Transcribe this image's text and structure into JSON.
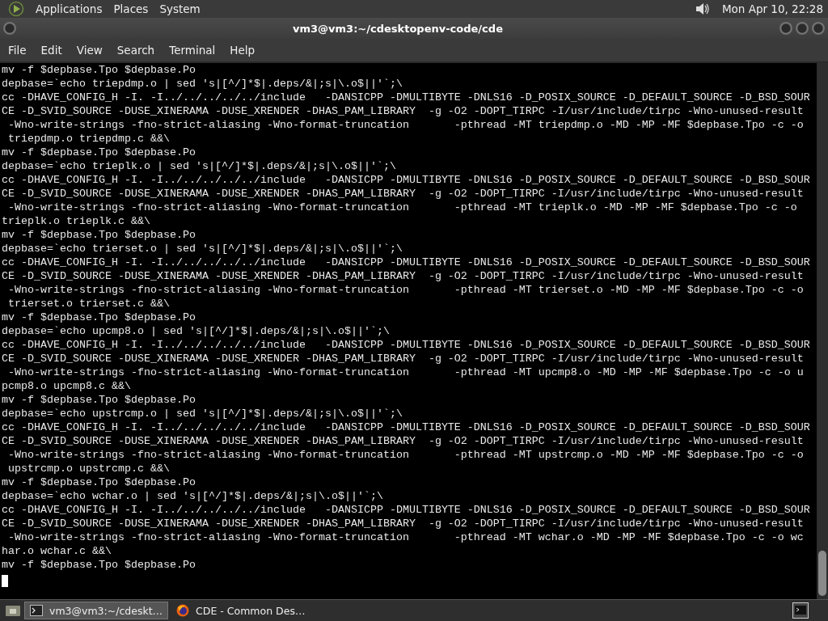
{
  "top_panel": {
    "menus": [
      "Applications",
      "Places",
      "System"
    ],
    "clock": "Mon Apr 10, 22:28"
  },
  "window": {
    "title": "vm3@vm3:~/cdesktopenv-code/cde"
  },
  "menu_bar": [
    "File",
    "Edit",
    "View",
    "Search",
    "Terminal",
    "Help"
  ],
  "terminal": {
    "lines": [
      "mv -f $depbase.Tpo $depbase.Po",
      "depbase=`echo triepdmp.o | sed 's|[^/]*$|.deps/&|;s|\\.o$||'`;\\",
      "cc -DHAVE_CONFIG_H -I. -I../../../../../include   -DANSICPP -DMULTIBYTE -DNLS16 -D_POSIX_SOURCE -D_DEFAULT_SOURCE -D_BSD_SOUR",
      "CE -D_SVID_SOURCE -DUSE_XINERAMA -DUSE_XRENDER -DHAS_PAM_LIBRARY  -g -O2 -DOPT_TIRPC -I/usr/include/tirpc -Wno-unused-result",
      " -Wno-write-strings -fno-strict-aliasing -Wno-format-truncation       -pthread -MT triepdmp.o -MD -MP -MF $depbase.Tpo -c -o",
      " triepdmp.o triepdmp.c &&\\",
      "mv -f $depbase.Tpo $depbase.Po",
      "depbase=`echo trieplk.o | sed 's|[^/]*$|.deps/&|;s|\\.o$||'`;\\",
      "cc -DHAVE_CONFIG_H -I. -I../../../../../include   -DANSICPP -DMULTIBYTE -DNLS16 -D_POSIX_SOURCE -D_DEFAULT_SOURCE -D_BSD_SOUR",
      "CE -D_SVID_SOURCE -DUSE_XINERAMA -DUSE_XRENDER -DHAS_PAM_LIBRARY  -g -O2 -DOPT_TIRPC -I/usr/include/tirpc -Wno-unused-result",
      " -Wno-write-strings -fno-strict-aliasing -Wno-format-truncation       -pthread -MT trieplk.o -MD -MP -MF $depbase.Tpo -c -o",
      "trieplk.o trieplk.c &&\\",
      "mv -f $depbase.Tpo $depbase.Po",
      "depbase=`echo trierset.o | sed 's|[^/]*$|.deps/&|;s|\\.o$||'`;\\",
      "cc -DHAVE_CONFIG_H -I. -I../../../../../include   -DANSICPP -DMULTIBYTE -DNLS16 -D_POSIX_SOURCE -D_DEFAULT_SOURCE -D_BSD_SOUR",
      "CE -D_SVID_SOURCE -DUSE_XINERAMA -DUSE_XRENDER -DHAS_PAM_LIBRARY  -g -O2 -DOPT_TIRPC -I/usr/include/tirpc -Wno-unused-result",
      " -Wno-write-strings -fno-strict-aliasing -Wno-format-truncation       -pthread -MT trierset.o -MD -MP -MF $depbase.Tpo -c -o",
      " trierset.o trierset.c &&\\",
      "mv -f $depbase.Tpo $depbase.Po",
      "depbase=`echo upcmp8.o | sed 's|[^/]*$|.deps/&|;s|\\.o$||'`;\\",
      "cc -DHAVE_CONFIG_H -I. -I../../../../../include   -DANSICPP -DMULTIBYTE -DNLS16 -D_POSIX_SOURCE -D_DEFAULT_SOURCE -D_BSD_SOUR",
      "CE -D_SVID_SOURCE -DUSE_XINERAMA -DUSE_XRENDER -DHAS_PAM_LIBRARY  -g -O2 -DOPT_TIRPC -I/usr/include/tirpc -Wno-unused-result",
      " -Wno-write-strings -fno-strict-aliasing -Wno-format-truncation       -pthread -MT upcmp8.o -MD -MP -MF $depbase.Tpo -c -o u",
      "pcmp8.o upcmp8.c &&\\",
      "mv -f $depbase.Tpo $depbase.Po",
      "depbase=`echo upstrcmp.o | sed 's|[^/]*$|.deps/&|;s|\\.o$||'`;\\",
      "cc -DHAVE_CONFIG_H -I. -I../../../../../include   -DANSICPP -DMULTIBYTE -DNLS16 -D_POSIX_SOURCE -D_DEFAULT_SOURCE -D_BSD_SOUR",
      "CE -D_SVID_SOURCE -DUSE_XINERAMA -DUSE_XRENDER -DHAS_PAM_LIBRARY  -g -O2 -DOPT_TIRPC -I/usr/include/tirpc -Wno-unused-result",
      " -Wno-write-strings -fno-strict-aliasing -Wno-format-truncation       -pthread -MT upstrcmp.o -MD -MP -MF $depbase.Tpo -c -o",
      " upstrcmp.o upstrcmp.c &&\\",
      "mv -f $depbase.Tpo $depbase.Po",
      "depbase=`echo wchar.o | sed 's|[^/]*$|.deps/&|;s|\\.o$||'`;\\",
      "cc -DHAVE_CONFIG_H -I. -I../../../../../include   -DANSICPP -DMULTIBYTE -DNLS16 -D_POSIX_SOURCE -D_DEFAULT_SOURCE -D_BSD_SOUR",
      "CE -D_SVID_SOURCE -DUSE_XINERAMA -DUSE_XRENDER -DHAS_PAM_LIBRARY  -g -O2 -DOPT_TIRPC -I/usr/include/tirpc -Wno-unused-result",
      " -Wno-write-strings -fno-strict-aliasing -Wno-format-truncation       -pthread -MT wchar.o -MD -MP -MF $depbase.Tpo -c -o wc",
      "har.o wchar.c &&\\",
      "mv -f $depbase.Tpo $depbase.Po"
    ]
  },
  "taskbar": {
    "items": [
      {
        "label": "vm3@vm3:~/cdeskt…",
        "kind": "terminal",
        "selected": true
      },
      {
        "label": "CDE - Common Des…",
        "kind": "browser",
        "selected": false
      }
    ]
  }
}
